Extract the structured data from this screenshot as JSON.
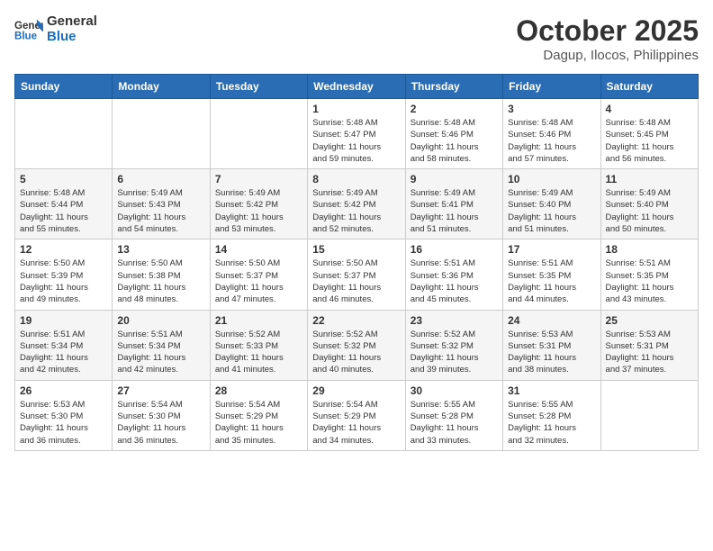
{
  "header": {
    "logo_line1": "General",
    "logo_line2": "Blue",
    "month": "October 2025",
    "location": "Dagup, Ilocos, Philippines"
  },
  "weekdays": [
    "Sunday",
    "Monday",
    "Tuesday",
    "Wednesday",
    "Thursday",
    "Friday",
    "Saturday"
  ],
  "weeks": [
    [
      {
        "day": "",
        "info": ""
      },
      {
        "day": "",
        "info": ""
      },
      {
        "day": "",
        "info": ""
      },
      {
        "day": "1",
        "info": "Sunrise: 5:48 AM\nSunset: 5:47 PM\nDaylight: 11 hours\nand 59 minutes."
      },
      {
        "day": "2",
        "info": "Sunrise: 5:48 AM\nSunset: 5:46 PM\nDaylight: 11 hours\nand 58 minutes."
      },
      {
        "day": "3",
        "info": "Sunrise: 5:48 AM\nSunset: 5:46 PM\nDaylight: 11 hours\nand 57 minutes."
      },
      {
        "day": "4",
        "info": "Sunrise: 5:48 AM\nSunset: 5:45 PM\nDaylight: 11 hours\nand 56 minutes."
      }
    ],
    [
      {
        "day": "5",
        "info": "Sunrise: 5:48 AM\nSunset: 5:44 PM\nDaylight: 11 hours\nand 55 minutes."
      },
      {
        "day": "6",
        "info": "Sunrise: 5:49 AM\nSunset: 5:43 PM\nDaylight: 11 hours\nand 54 minutes."
      },
      {
        "day": "7",
        "info": "Sunrise: 5:49 AM\nSunset: 5:42 PM\nDaylight: 11 hours\nand 53 minutes."
      },
      {
        "day": "8",
        "info": "Sunrise: 5:49 AM\nSunset: 5:42 PM\nDaylight: 11 hours\nand 52 minutes."
      },
      {
        "day": "9",
        "info": "Sunrise: 5:49 AM\nSunset: 5:41 PM\nDaylight: 11 hours\nand 51 minutes."
      },
      {
        "day": "10",
        "info": "Sunrise: 5:49 AM\nSunset: 5:40 PM\nDaylight: 11 hours\nand 51 minutes."
      },
      {
        "day": "11",
        "info": "Sunrise: 5:49 AM\nSunset: 5:40 PM\nDaylight: 11 hours\nand 50 minutes."
      }
    ],
    [
      {
        "day": "12",
        "info": "Sunrise: 5:50 AM\nSunset: 5:39 PM\nDaylight: 11 hours\nand 49 minutes."
      },
      {
        "day": "13",
        "info": "Sunrise: 5:50 AM\nSunset: 5:38 PM\nDaylight: 11 hours\nand 48 minutes."
      },
      {
        "day": "14",
        "info": "Sunrise: 5:50 AM\nSunset: 5:37 PM\nDaylight: 11 hours\nand 47 minutes."
      },
      {
        "day": "15",
        "info": "Sunrise: 5:50 AM\nSunset: 5:37 PM\nDaylight: 11 hours\nand 46 minutes."
      },
      {
        "day": "16",
        "info": "Sunrise: 5:51 AM\nSunset: 5:36 PM\nDaylight: 11 hours\nand 45 minutes."
      },
      {
        "day": "17",
        "info": "Sunrise: 5:51 AM\nSunset: 5:35 PM\nDaylight: 11 hours\nand 44 minutes."
      },
      {
        "day": "18",
        "info": "Sunrise: 5:51 AM\nSunset: 5:35 PM\nDaylight: 11 hours\nand 43 minutes."
      }
    ],
    [
      {
        "day": "19",
        "info": "Sunrise: 5:51 AM\nSunset: 5:34 PM\nDaylight: 11 hours\nand 42 minutes."
      },
      {
        "day": "20",
        "info": "Sunrise: 5:51 AM\nSunset: 5:34 PM\nDaylight: 11 hours\nand 42 minutes."
      },
      {
        "day": "21",
        "info": "Sunrise: 5:52 AM\nSunset: 5:33 PM\nDaylight: 11 hours\nand 41 minutes."
      },
      {
        "day": "22",
        "info": "Sunrise: 5:52 AM\nSunset: 5:32 PM\nDaylight: 11 hours\nand 40 minutes."
      },
      {
        "day": "23",
        "info": "Sunrise: 5:52 AM\nSunset: 5:32 PM\nDaylight: 11 hours\nand 39 minutes."
      },
      {
        "day": "24",
        "info": "Sunrise: 5:53 AM\nSunset: 5:31 PM\nDaylight: 11 hours\nand 38 minutes."
      },
      {
        "day": "25",
        "info": "Sunrise: 5:53 AM\nSunset: 5:31 PM\nDaylight: 11 hours\nand 37 minutes."
      }
    ],
    [
      {
        "day": "26",
        "info": "Sunrise: 5:53 AM\nSunset: 5:30 PM\nDaylight: 11 hours\nand 36 minutes."
      },
      {
        "day": "27",
        "info": "Sunrise: 5:54 AM\nSunset: 5:30 PM\nDaylight: 11 hours\nand 36 minutes."
      },
      {
        "day": "28",
        "info": "Sunrise: 5:54 AM\nSunset: 5:29 PM\nDaylight: 11 hours\nand 35 minutes."
      },
      {
        "day": "29",
        "info": "Sunrise: 5:54 AM\nSunset: 5:29 PM\nDaylight: 11 hours\nand 34 minutes."
      },
      {
        "day": "30",
        "info": "Sunrise: 5:55 AM\nSunset: 5:28 PM\nDaylight: 11 hours\nand 33 minutes."
      },
      {
        "day": "31",
        "info": "Sunrise: 5:55 AM\nSunset: 5:28 PM\nDaylight: 11 hours\nand 32 minutes."
      },
      {
        "day": "",
        "info": ""
      }
    ]
  ]
}
